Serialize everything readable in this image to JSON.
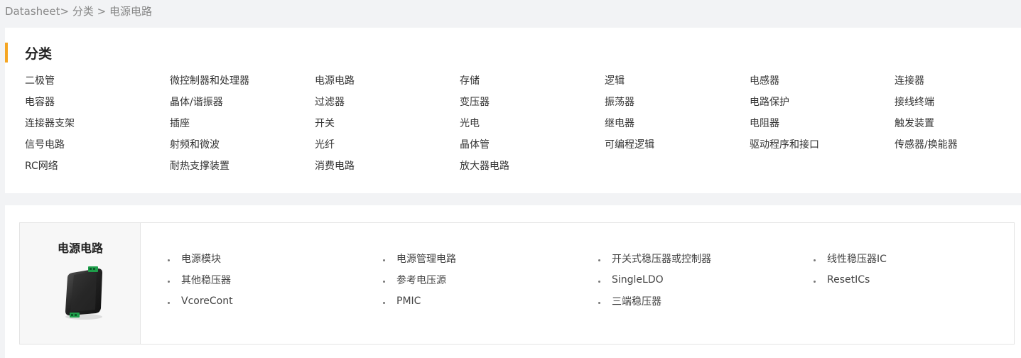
{
  "breadcrumb": {
    "root": "Datasheet>",
    "level1": "分类 >",
    "current": "电源电路"
  },
  "categories": {
    "title": "分类",
    "items": [
      "二极管",
      "微控制器和处理器",
      "电源电路",
      "存储",
      "逻辑",
      "电感器",
      "连接器",
      "电容器",
      "晶体/谐振器",
      "过滤器",
      "变压器",
      "振荡器",
      "电路保护",
      "接线终端",
      "连接器支架",
      "插座",
      "开关",
      "光电",
      "继电器",
      "电阻器",
      "触发装置",
      "信号电路",
      "射频和微波",
      "光纤",
      "晶体管",
      "可编程逻辑",
      "驱动程序和接口",
      "传感器/换能器",
      "RC网络",
      "耐热支撑装置",
      "消费电路",
      "放大器电路"
    ]
  },
  "subcategory": {
    "title": "电源电路",
    "image_icon": "power-module-image",
    "items": [
      "电源模块",
      "电源管理电路",
      "开关式稳压器或控制器",
      "线性稳压器IC",
      "其他稳压器",
      "参考电压源",
      "SingleLDO",
      "ResetICs",
      "VcoreCont",
      "PMIC",
      "三端稳压器"
    ]
  },
  "colors": {
    "accent": "#f5a623",
    "page_bg": "#f2f3f5",
    "panel_bg": "#ffffff"
  }
}
